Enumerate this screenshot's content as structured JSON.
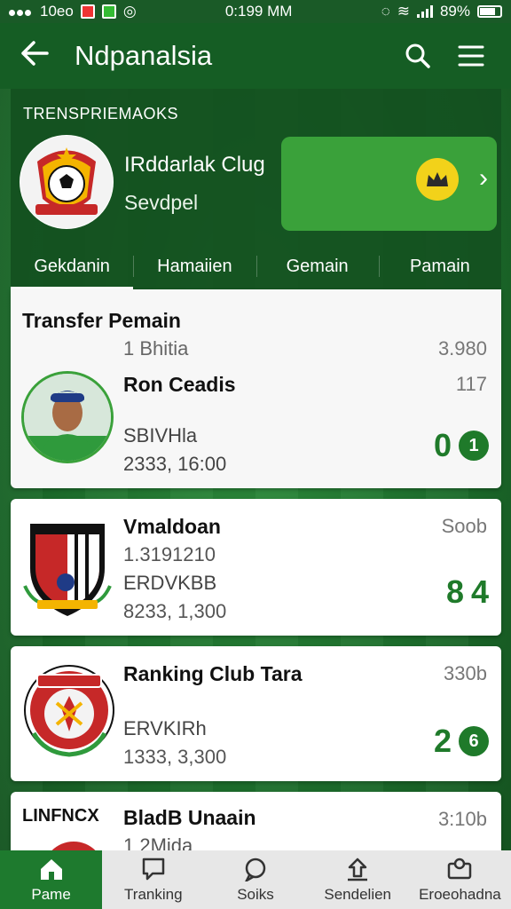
{
  "status_bar": {
    "carrier": "10eo",
    "time": "0:199 MM",
    "battery": "89%"
  },
  "app_bar": {
    "title": "Ndpanalsia"
  },
  "header": {
    "section_label": "TRENSPRIEMAOKS",
    "club_name": "IRddarlak Clug",
    "club_subtitle": "Sevdpel",
    "tabs": [
      {
        "label": "Gekdanin",
        "active": true
      },
      {
        "label": "Hamaiien",
        "active": false
      },
      {
        "label": "Gemain",
        "active": false
      },
      {
        "label": "Pamain",
        "active": false
      }
    ]
  },
  "cards": [
    {
      "section_title": "Transfer Pemain",
      "subline": "1 Bhitia",
      "subline_right": "3.980",
      "name": "Ron Ceadis",
      "name_right": "117",
      "meta1": "SBIVHla",
      "meta2": "2333, 16:00",
      "score_main": "0",
      "score_badge": "1"
    },
    {
      "name": "Vmaldoan",
      "name_right": "Soob",
      "meta_line1": "1.3191210",
      "meta1": "ERDVKBB",
      "meta2": "8233, 1,300",
      "score_main": "8",
      "score_badge": "4"
    },
    {
      "name": "Ranking Club Tara",
      "name_right": "330b",
      "meta1": "ERVKIRh",
      "meta2": "1333, 3,300",
      "score_main": "2",
      "score_badge": "6"
    },
    {
      "left_label": "LINFNCX",
      "name": "BladB Unaain",
      "name_right": "3:10b",
      "meta_line1": "1 2Mida"
    }
  ],
  "bottom_nav": [
    {
      "label": "Pame",
      "icon": "home-icon",
      "active": true
    },
    {
      "label": "Tranking",
      "icon": "message-square-icon",
      "active": false
    },
    {
      "label": "Soiks",
      "icon": "chat-bubble-icon",
      "active": false
    },
    {
      "label": "Sendelien",
      "icon": "upload-icon",
      "active": false
    },
    {
      "label": "Eroeohadna",
      "icon": "profile-card-icon",
      "active": false
    }
  ],
  "colors": {
    "primary_green": "#155d24",
    "accent_green": "#3aa13a",
    "score_green": "#1f7a2a",
    "coin_yellow": "#f2d21a"
  }
}
